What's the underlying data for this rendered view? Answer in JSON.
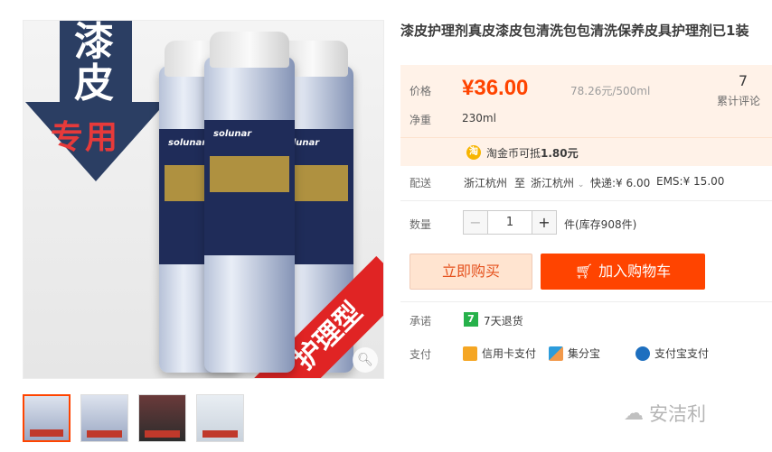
{
  "product": {
    "title": "漆皮护理剂真皮漆皮包清洗包包清洗保养皮具护理剂已1装",
    "image": {
      "vertical_text_1": "漆",
      "vertical_text_2": "皮",
      "red_text": "专用",
      "brand": "solunar",
      "diagonal_text": "护理型"
    }
  },
  "price_box": {
    "price_label": "价格",
    "price": "¥36.00",
    "unit_price": "78.26元/500ml",
    "review_count": "7",
    "review_label": "累计评论",
    "weight_label": "净重",
    "weight_value": "230ml"
  },
  "coin": {
    "icon": "淘",
    "text_prefix": "淘金币可抵",
    "amount": "1.80元"
  },
  "shipping": {
    "label": "配送",
    "from": "浙江杭州",
    "to_word": "至",
    "to": "浙江杭州",
    "express": "快递:¥ 6.00",
    "ems": "EMS:¥ 15.00"
  },
  "quantity": {
    "label": "数量",
    "minus": "−",
    "value": "1",
    "plus": "+",
    "stock": "件(库存908件)"
  },
  "actions": {
    "buy_now": "立即购买",
    "add_cart": "加入购物车"
  },
  "promise": {
    "label": "承诺",
    "icon": "7",
    "text": "7天退货"
  },
  "payment": {
    "label": "支付",
    "credit": "信用卡支付",
    "jifen": "集分宝",
    "alipay": "支付宝支付"
  },
  "watermark": "安洁利",
  "colors": {
    "accent": "#ff4400",
    "price_bg": "#fff2e8",
    "navy": "#2b3e63"
  }
}
